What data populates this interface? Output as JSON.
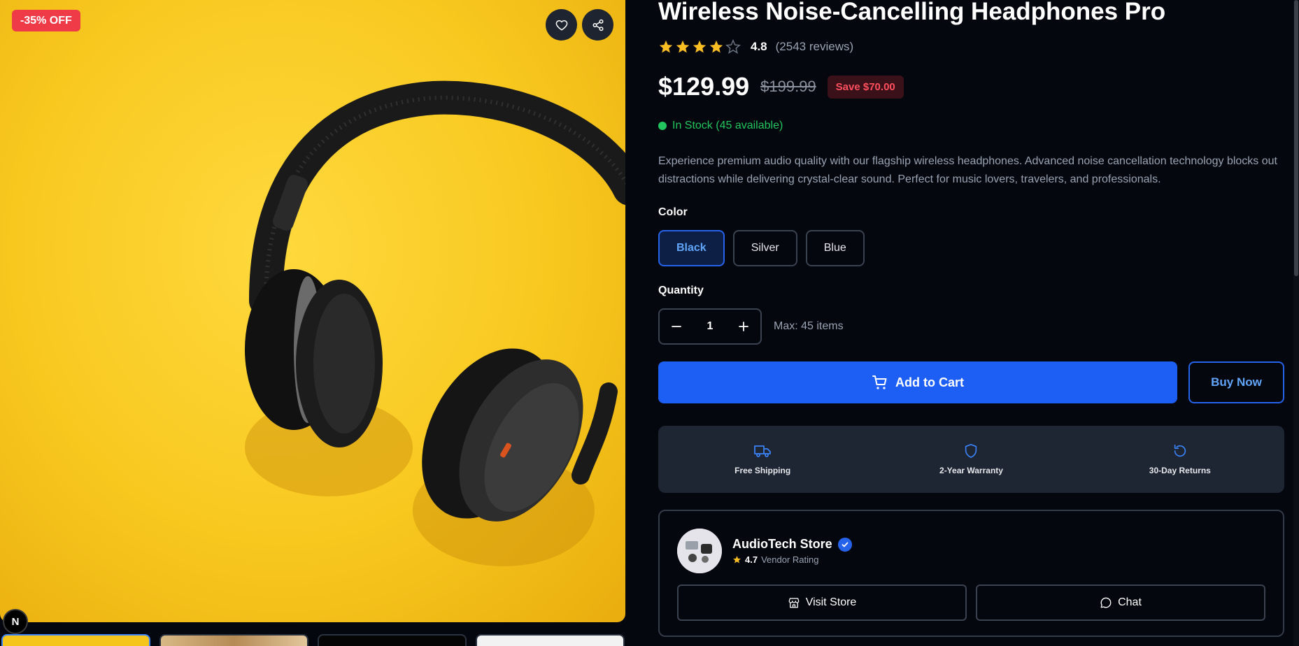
{
  "product": {
    "title": "Wireless Noise-Cancelling Headphones Pro",
    "rating": "4.8",
    "rating_stars": 4,
    "rating_max": 5,
    "reviews": "(2543 reviews)",
    "price": "$129.99",
    "old_price": "$199.99",
    "save_badge": "Save $70.00",
    "stock": "In Stock (45 available)",
    "description": "Experience premium audio quality with our flagship wireless headphones. Advanced noise cancellation technology blocks out distractions while delivering crystal-clear sound. Perfect for music lovers, travelers, and professionals."
  },
  "gallery": {
    "discount_badge": "-35% OFF",
    "thumbnail_count": 4,
    "selected_thumbnail": 1,
    "badge_logo": "N"
  },
  "options": {
    "color_label": "Color",
    "colors": [
      "Black",
      "Silver",
      "Blue"
    ],
    "selected_color": "Black",
    "quantity_label": "Quantity",
    "quantity": "1",
    "max_note": "Max: 45 items"
  },
  "actions": {
    "add_to_cart": "Add to Cart",
    "buy_now": "Buy Now"
  },
  "features": [
    {
      "label": "Free Shipping",
      "icon": "truck-icon"
    },
    {
      "label": "2-Year Warranty",
      "icon": "shield-icon"
    },
    {
      "label": "30-Day Returns",
      "icon": "rotate-icon"
    }
  ],
  "vendor": {
    "name": "AudioTech Store",
    "rating": "4.7",
    "rating_label": "Vendor Rating",
    "visit_label": "Visit Store",
    "chat_label": "Chat"
  },
  "colors": {
    "accent": "#1d5ff5",
    "star": "#fbbf24",
    "success": "#22c55e",
    "danger": "#ef3b48",
    "background": "#04070e",
    "panel": "#1e2633"
  }
}
